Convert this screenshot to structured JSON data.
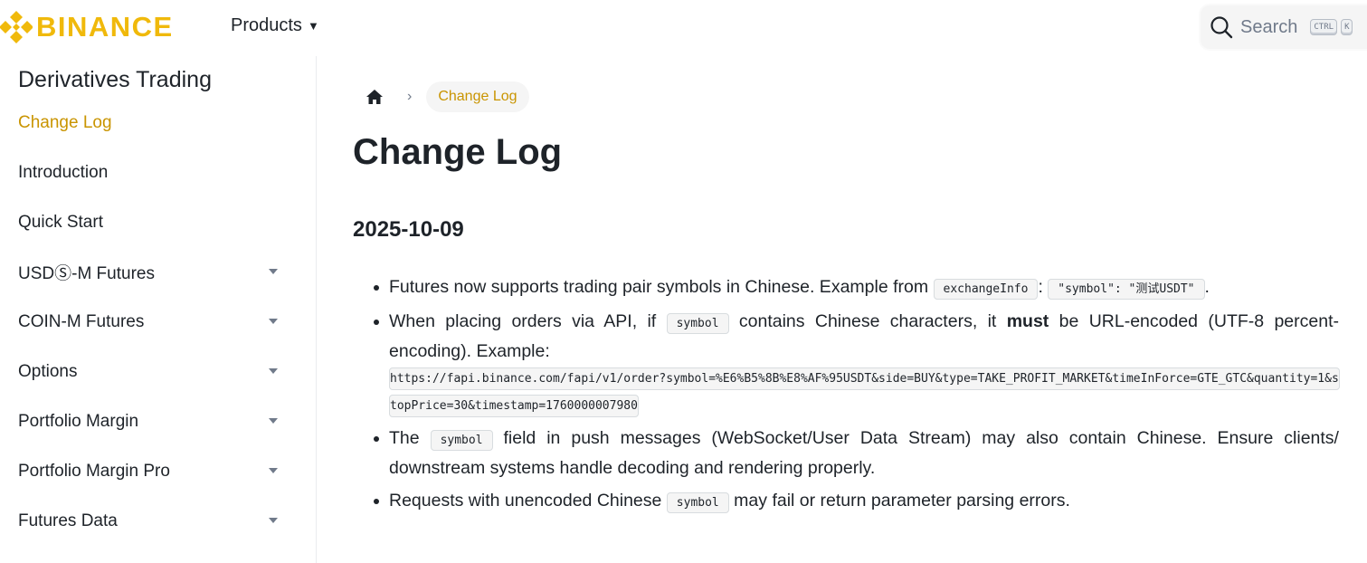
{
  "brand": {
    "name": "BINANCE",
    "color": "#f0b90b"
  },
  "nav": {
    "products_label": "Products",
    "products_caret": "▼"
  },
  "search": {
    "label": "Search",
    "shortcut_key1": "CTRL",
    "shortcut_key2": "K",
    "icon": "search-icon"
  },
  "sidebar": {
    "title": "Derivatives Trading",
    "items": [
      {
        "label": "Change Log",
        "active": true,
        "expandable": false
      },
      {
        "label": "Introduction",
        "active": false,
        "expandable": false
      },
      {
        "label": "Quick Start",
        "active": false,
        "expandable": false
      },
      {
        "label": "USDⓈ-M Futures",
        "active": false,
        "expandable": true
      },
      {
        "label": "COIN-M Futures",
        "active": false,
        "expandable": true
      },
      {
        "label": "Options",
        "active": false,
        "expandable": true
      },
      {
        "label": "Portfolio Margin",
        "active": false,
        "expandable": true
      },
      {
        "label": "Portfolio Margin Pro",
        "active": false,
        "expandable": true
      },
      {
        "label": "Futures Data",
        "active": false,
        "expandable": true
      }
    ]
  },
  "breadcrumb": {
    "home_icon": "home-icon",
    "separator": "›",
    "current": "Change Log"
  },
  "page": {
    "title": "Change Log",
    "section_date": "2025-10-09",
    "bullets": {
      "b1_text": "Futures now supports trading pair symbols in Chinese. Example from ",
      "b1_code1": "exchangeInfo",
      "b1_sep": ": ",
      "b1_code2": "\"symbol\": \"测试USDT\"",
      "b1_end": ".",
      "b2_text1": "When placing orders via API, if ",
      "b2_code": "symbol",
      "b2_text2": " contains Chinese characters, it ",
      "b2_strong": "must",
      "b2_text3": " be URL-encoded (UTF-8 percent-encoding). Example:",
      "b2_url": "https://fapi.binance.com/fapi/v1/order?symbol=%E6%B5%8B%E8%AF%95USDT&side=BUY&type=TAKE_PROFIT_MARKET&timeInForce=GTE_GTC&quantity=1&stopPrice=30&timestamp=1760000007980",
      "b3_text1": "The ",
      "b3_code": "symbol",
      "b3_text2": " field in push messages (WebSocket/User Data Stream) may also contain Chinese. Ensure clients/ downstream systems handle decoding and rendering properly.",
      "b4_text1": "Requests with unencoded Chinese ",
      "b4_code": "symbol",
      "b4_text2": " may fail or return parameter parsing errors."
    }
  },
  "colors": {
    "accent": "#c99400",
    "text": "#1e2329",
    "muted": "#707a8a",
    "surface": "#f5f5f5"
  }
}
